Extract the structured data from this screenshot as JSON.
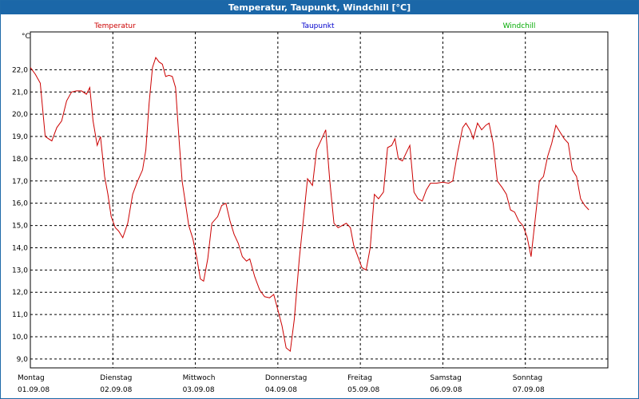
{
  "window": {
    "title": "Temperatur, Taupunkt, Windchill [°C]"
  },
  "chart_data": {
    "type": "line",
    "title": "Temperatur, Taupunkt, Windchill [°C]",
    "ylabel": "°C",
    "ylim": [
      8.6,
      23.7
    ],
    "xlim": [
      0,
      7.0
    ],
    "grid": true,
    "legend_position": "top",
    "y_ticks": [
      9.0,
      10.0,
      11.0,
      12.0,
      13.0,
      14.0,
      15.0,
      16.0,
      17.0,
      18.0,
      19.0,
      20.0,
      21.0,
      22.0
    ],
    "y_tick_labels": [
      "9,0",
      "10,0",
      "11,0",
      "12,0",
      "13,0",
      "14,0",
      "15,0",
      "16,0",
      "17,0",
      "18,0",
      "19,0",
      "20,0",
      "21,0",
      "22,0"
    ],
    "x_ticks": [
      {
        "day": "Montag",
        "date": "01.09.08"
      },
      {
        "day": "Dienstag",
        "date": "02.09.08"
      },
      {
        "day": "Mittwoch",
        "date": "03.09.08"
      },
      {
        "day": "Donnerstag",
        "date": "04.09.08"
      },
      {
        "day": "Freitag",
        "date": "05.09.08"
      },
      {
        "day": "Samstag",
        "date": "06.09.08"
      },
      {
        "day": "Sonntag",
        "date": "07.09.08"
      }
    ],
    "legend": [
      {
        "name": "Temperatur",
        "color": "#cc0000"
      },
      {
        "name": "Taupunkt",
        "color": "#0000cc"
      },
      {
        "name": "Windchill",
        "color": "#00aa00"
      }
    ],
    "series": [
      {
        "name": "Temperatur",
        "color": "#cc0000",
        "points": [
          [
            0.0,
            22.1
          ],
          [
            0.06,
            21.8
          ],
          [
            0.12,
            21.4
          ],
          [
            0.18,
            19.0
          ],
          [
            0.22,
            18.9
          ],
          [
            0.26,
            18.8
          ],
          [
            0.32,
            19.4
          ],
          [
            0.38,
            19.7
          ],
          [
            0.44,
            20.6
          ],
          [
            0.5,
            21.0
          ],
          [
            0.56,
            21.05
          ],
          [
            0.62,
            21.05
          ],
          [
            0.68,
            20.9
          ],
          [
            0.72,
            21.2
          ],
          [
            0.76,
            19.7
          ],
          [
            0.81,
            18.6
          ],
          [
            0.85,
            19.0
          ],
          [
            0.9,
            17.2
          ],
          [
            0.94,
            16.4
          ],
          [
            0.98,
            15.4
          ],
          [
            1.03,
            14.9
          ],
          [
            1.07,
            14.75
          ],
          [
            1.12,
            14.45
          ],
          [
            1.18,
            15.1
          ],
          [
            1.24,
            16.4
          ],
          [
            1.3,
            17.0
          ],
          [
            1.36,
            17.5
          ],
          [
            1.4,
            18.4
          ],
          [
            1.44,
            20.5
          ],
          [
            1.48,
            22.1
          ],
          [
            1.52,
            22.55
          ],
          [
            1.56,
            22.35
          ],
          [
            1.6,
            22.25
          ],
          [
            1.64,
            21.7
          ],
          [
            1.68,
            21.75
          ],
          [
            1.72,
            21.7
          ],
          [
            1.76,
            21.2
          ],
          [
            1.8,
            19.0
          ],
          [
            1.84,
            17.0
          ],
          [
            1.88,
            16.0
          ],
          [
            1.92,
            15.0
          ],
          [
            1.97,
            14.4
          ],
          [
            2.02,
            13.5
          ],
          [
            2.06,
            12.6
          ],
          [
            2.1,
            12.5
          ],
          [
            2.15,
            13.5
          ],
          [
            2.2,
            15.1
          ],
          [
            2.27,
            15.4
          ],
          [
            2.32,
            15.9
          ],
          [
            2.37,
            16.0
          ],
          [
            2.42,
            15.2
          ],
          [
            2.47,
            14.6
          ],
          [
            2.52,
            14.2
          ],
          [
            2.57,
            13.6
          ],
          [
            2.62,
            13.4
          ],
          [
            2.66,
            13.5
          ],
          [
            2.72,
            12.7
          ],
          [
            2.78,
            12.1
          ],
          [
            2.84,
            11.8
          ],
          [
            2.9,
            11.75
          ],
          [
            2.95,
            11.9
          ],
          [
            3.0,
            11.2
          ],
          [
            3.05,
            10.5
          ],
          [
            3.1,
            9.5
          ],
          [
            3.15,
            9.35
          ],
          [
            3.2,
            10.8
          ],
          [
            3.26,
            13.5
          ],
          [
            3.31,
            15.3
          ],
          [
            3.36,
            17.1
          ],
          [
            3.42,
            16.8
          ],
          [
            3.47,
            18.4
          ],
          [
            3.52,
            18.8
          ],
          [
            3.58,
            19.3
          ],
          [
            3.63,
            17.0
          ],
          [
            3.68,
            15.1
          ],
          [
            3.73,
            14.9
          ],
          [
            3.78,
            15.0
          ],
          [
            3.83,
            15.1
          ],
          [
            3.88,
            14.9
          ],
          [
            3.92,
            14.1
          ],
          [
            3.97,
            13.6
          ],
          [
            4.02,
            13.1
          ],
          [
            4.07,
            13.0
          ],
          [
            4.12,
            14.0
          ],
          [
            4.17,
            16.4
          ],
          [
            4.22,
            16.2
          ],
          [
            4.28,
            16.5
          ],
          [
            4.33,
            18.5
          ],
          [
            4.38,
            18.6
          ],
          [
            4.42,
            18.9
          ],
          [
            4.46,
            18.0
          ],
          [
            4.51,
            17.9
          ],
          [
            4.56,
            18.3
          ],
          [
            4.6,
            18.6
          ],
          [
            4.65,
            16.5
          ],
          [
            4.7,
            16.2
          ],
          [
            4.75,
            16.1
          ],
          [
            4.8,
            16.6
          ],
          [
            4.85,
            16.9
          ],
          [
            4.92,
            16.9
          ],
          [
            5.0,
            16.95
          ],
          [
            5.07,
            16.9
          ],
          [
            5.12,
            17.0
          ],
          [
            5.18,
            18.3
          ],
          [
            5.24,
            19.4
          ],
          [
            5.28,
            19.6
          ],
          [
            5.33,
            19.3
          ],
          [
            5.37,
            18.9
          ],
          [
            5.42,
            19.6
          ],
          [
            5.47,
            19.3
          ],
          [
            5.52,
            19.5
          ],
          [
            5.56,
            19.6
          ],
          [
            5.61,
            18.7
          ],
          [
            5.66,
            17.0
          ],
          [
            5.72,
            16.7
          ],
          [
            5.77,
            16.4
          ],
          [
            5.82,
            15.7
          ],
          [
            5.87,
            15.6
          ],
          [
            5.92,
            15.2
          ],
          [
            5.97,
            15.0
          ],
          [
            6.02,
            14.5
          ],
          [
            6.07,
            13.6
          ],
          [
            6.12,
            15.3
          ],
          [
            6.17,
            17.0
          ],
          [
            6.22,
            17.2
          ],
          [
            6.27,
            18.1
          ],
          [
            6.32,
            18.7
          ],
          [
            6.37,
            19.5
          ],
          [
            6.42,
            19.2
          ],
          [
            6.47,
            18.9
          ],
          [
            6.52,
            18.7
          ],
          [
            6.57,
            17.5
          ],
          [
            6.62,
            17.2
          ],
          [
            6.67,
            16.2
          ],
          [
            6.72,
            15.9
          ],
          [
            6.77,
            15.7
          ]
        ]
      }
    ]
  }
}
